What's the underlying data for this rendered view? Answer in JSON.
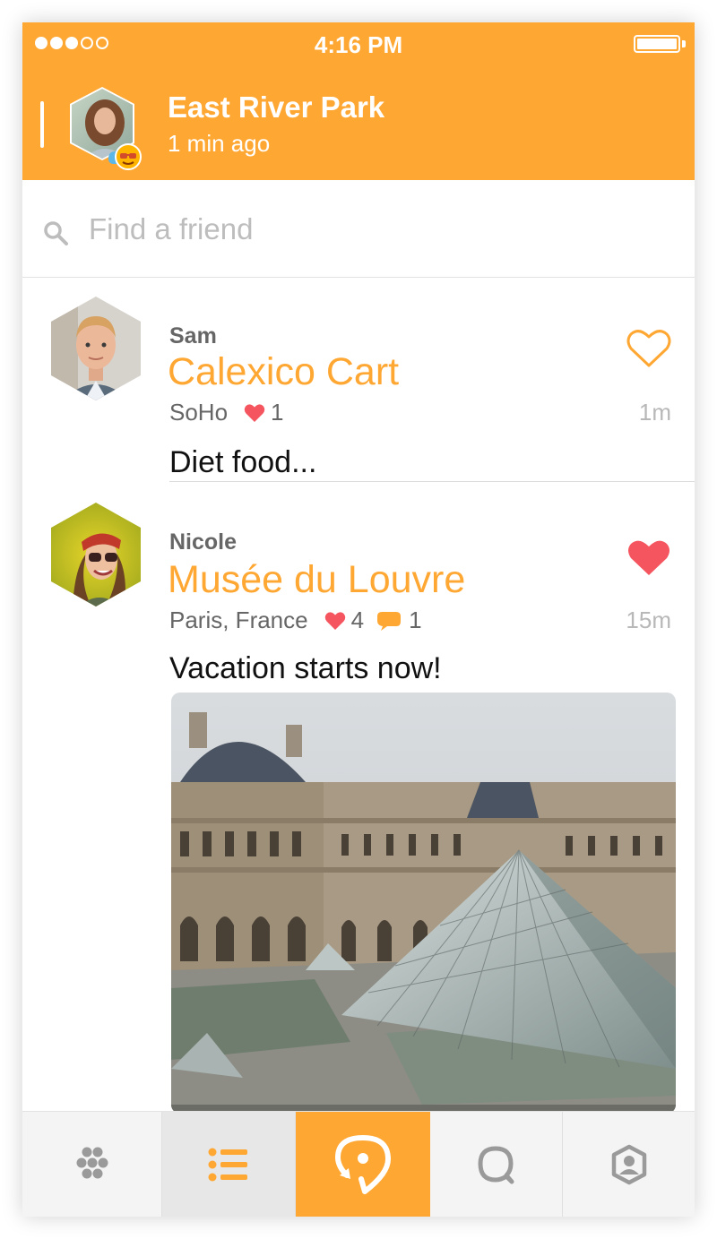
{
  "status_bar": {
    "time": "4:16 PM",
    "signal_dots_filled": 3,
    "signal_dots_total": 5
  },
  "header": {
    "title": "East River Park",
    "subtitle": "1 min ago",
    "badge_icon": "sunny-weather-icon"
  },
  "search": {
    "placeholder": "Find a friend",
    "value": ""
  },
  "posts": [
    {
      "author": "Sam",
      "place": "Calexico Cart",
      "location": "SoHo",
      "likes": "1",
      "caption": "Diet food...",
      "time_ago": "1m",
      "liked_by_me": false
    },
    {
      "author": "Nicole",
      "place": "Musée du Louvre",
      "location": "Paris, France",
      "likes": "4",
      "comments": "1",
      "caption": "Vacation starts now!",
      "time_ago": "15m",
      "liked_by_me": true,
      "photo_subject": "Louvre museum glass pyramid"
    }
  ],
  "tabs": [
    {
      "name": "explore",
      "icon": "hexagon-dots-icon",
      "active": false
    },
    {
      "name": "feed",
      "icon": "list-icon",
      "active": true
    },
    {
      "name": "check-in",
      "icon": "location-refresh-icon",
      "active": false
    },
    {
      "name": "messages",
      "icon": "chat-bubble-icon",
      "active": false
    },
    {
      "name": "profile",
      "icon": "profile-icon",
      "active": false
    }
  ],
  "colors": {
    "accent": "#FFA733",
    "heart": "#F5555F",
    "text_muted": "#666666"
  }
}
